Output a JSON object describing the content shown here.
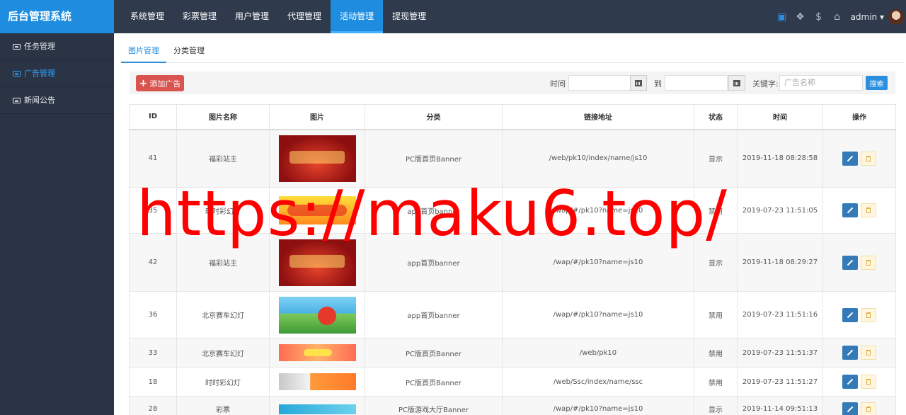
{
  "app": {
    "title": "后台管理系统"
  },
  "topnav": [
    {
      "label": "系统管理"
    },
    {
      "label": "彩票管理"
    },
    {
      "label": "用户管理"
    },
    {
      "label": "代理管理"
    },
    {
      "label": "活动管理"
    },
    {
      "label": "提现管理"
    }
  ],
  "topnav_active": "活动管理",
  "user": {
    "name": "admin ▾"
  },
  "sidebar": [
    {
      "label": "任务管理"
    },
    {
      "label": "广告管理"
    },
    {
      "label": "新闻公告"
    }
  ],
  "tabs": [
    {
      "label": "图片管理"
    },
    {
      "label": "分类管理"
    }
  ],
  "toolbar": {
    "add_label": "添加广告",
    "time_label": "时间",
    "to_label": "到",
    "keyword_label": "关键字:",
    "keyword_placeholder": "广告名称",
    "search_label": "搜索"
  },
  "table": {
    "headers": [
      "ID",
      "图片名称",
      "图片",
      "分类",
      "链接地址",
      "状态",
      "时间",
      "操作"
    ],
    "rows": [
      {
        "id": "41",
        "name": "福彩站主",
        "category": "PC版首页Banner",
        "link": "/web/pk10/index/name/js10",
        "status": "显示",
        "time": "2019-11-18 08:28:58"
      },
      {
        "id": "35",
        "name": "时时彩幻灯",
        "category": "app首页banner",
        "link": "/wap/#/pk10?name=js10",
        "status": "禁用",
        "time": "2019-07-23 11:51:05"
      },
      {
        "id": "42",
        "name": "福彩站主",
        "category": "app首页banner",
        "link": "/wap/#/pk10?name=js10",
        "status": "显示",
        "time": "2019-11-18 08:29:27"
      },
      {
        "id": "36",
        "name": "北京赛车幻灯",
        "category": "app首页banner",
        "link": "/wap/#/pk10?name=js10",
        "status": "禁用",
        "time": "2019-07-23 11:51:16"
      },
      {
        "id": "33",
        "name": "北京赛车幻灯",
        "category": "PC版首页Banner",
        "link": "/web/pk10",
        "status": "禁用",
        "time": "2019-07-23 11:51:37"
      },
      {
        "id": "18",
        "name": "时时彩幻灯",
        "category": "PC版首页Banner",
        "link": "/web/Ssc/index/name/ssc",
        "status": "禁用",
        "time": "2019-07-23 11:51:27"
      },
      {
        "id": "28",
        "name": "彩票",
        "category": "PC版游戏大厅Banner",
        "link": "/wap/#/pk10?name=js10",
        "status": "显示",
        "time": "2019-11-14 09:51:13"
      }
    ]
  },
  "colors": {
    "brand": "#1e8de0",
    "topbar": "#2f3a4c",
    "sidebar": "#2b3444",
    "shown": "#5cb85c",
    "disabled": "#d9534f"
  },
  "watermark": "https://maku6.top/"
}
